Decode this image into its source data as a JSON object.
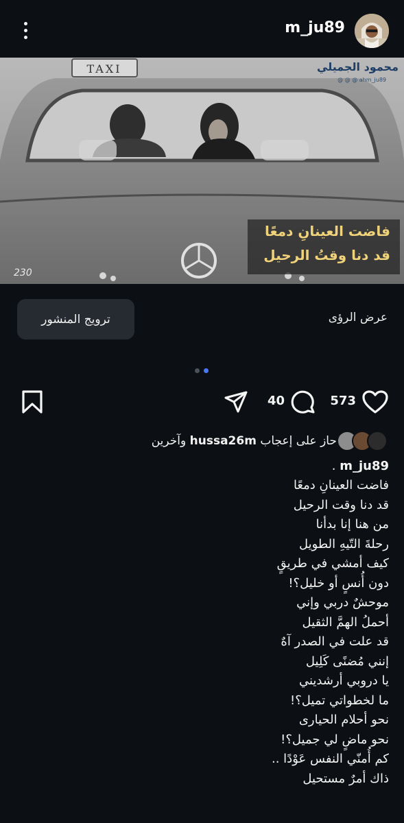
{
  "header": {
    "username": "m_ju89",
    "menu_icon": "more-vertical-icon",
    "avatar_icon": "profile-avatar"
  },
  "post_image": {
    "taxi_sign": "TAXI",
    "artist_signature": "محمود الجميلي",
    "artist_handle": "@ @ @ ahm_ju89",
    "overlay_line_1": "فاضت العينانِ دمعًا",
    "overlay_line_2": "قد دنا وقتُ الرحيل",
    "plate_text": "230"
  },
  "buttons": {
    "boost": "ترويج المنشور",
    "insights": "عرض الرؤى"
  },
  "carousel": {
    "count": 2,
    "active": 2
  },
  "actions": {
    "likes": "573",
    "comments": "40",
    "icons": [
      "heart-icon",
      "comment-icon",
      "share-icon",
      "bookmark-icon"
    ]
  },
  "liked_by": {
    "prefix": "حاز على إعجاب",
    "user": "hussa26m",
    "suffix": "وآخرين"
  },
  "caption": {
    "username": "m_ju89",
    "lines": [
      "فاضت العينانِ دمعًا",
      "قد دنا وقت الرحيل",
      "من هنا إنا بدأنا",
      "رحلةَ التّيهِ الطويل",
      "كيف أمشي في طريقٍ",
      "دون أُنسٍ أو خليل؟!",
      "موحشٌ دربي وإني",
      "أحملُ الهمَّ الثقيل",
      "قد علت في الصدر آهٌ",
      "إنني مُضنًى كَلِيل",
      "يا دروبي أرشديني",
      "ما لخطواتي تميل؟!",
      "نحو أحلام الحيارى",
      "نحو ماضٍ لي جميل؟!",
      "كم أُمنّي النفس عَوْدًا ..",
      "ذاك أمرٌ مستحيل"
    ]
  },
  "colors": {
    "background": "#0c1014",
    "accent_dot": "#4a78f5",
    "button_bg": "#262b31",
    "overlay_text": "#f0d27a"
  }
}
